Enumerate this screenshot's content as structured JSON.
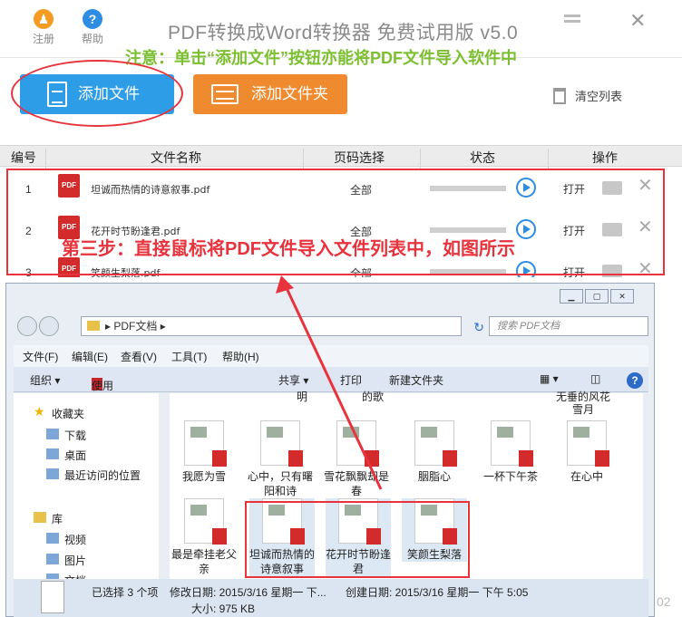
{
  "app": {
    "title": "PDF转换成Word转换器 免费试用版 v5.0",
    "notice": "注意：单击“添加文件”按钮亦能将PDF文件导入软件中",
    "register_label": "注册",
    "help_label": "帮助",
    "help_glyph": "?",
    "close_glyph": "✕"
  },
  "toolbar": {
    "add_file": "添加文件",
    "add_folder": "添加文件夹",
    "clear_list": "清空列表"
  },
  "table": {
    "headers": [
      "编号",
      "文件名称",
      "页码选择",
      "状态",
      "操作"
    ],
    "rows": [
      {
        "num": "1",
        "name": "坦诚而热情的诗意叙事.pdf",
        "pages": "全部",
        "open": "打开",
        "progress": 0,
        "pdf_tag": "PDF"
      },
      {
        "num": "2",
        "name": "花开时节盼逢君.pdf",
        "pages": "全部",
        "open": "打开",
        "progress": 0,
        "pdf_tag": "PDF"
      },
      {
        "num": "3",
        "name": "笑颜生梨落.pdf",
        "pages": "全部",
        "open": "打开",
        "progress": 0,
        "pdf_tag": "PDF"
      }
    ],
    "remove_glyph": "✕"
  },
  "annotation": {
    "step3": "第三步：直接鼠标将PDF文件导入文件列表中，如图所示"
  },
  "explorer": {
    "path": "PDF文档",
    "path_arrow": "▸",
    "search_placeholder": "搜索 PDF文档",
    "refresh_glyph": "↻",
    "menu": [
      "文件(F)",
      "编辑(E)",
      "查看(V)",
      "工具(T)",
      "帮助(H)"
    ],
    "commands": {
      "organize": "组织 ▾",
      "open_with": "使用 Adobe Reader XI 打开",
      "share": "共享 ▾",
      "print": "打印",
      "new_folder": "新建文件夹"
    },
    "sidebar": [
      {
        "label": "收藏夹"
      },
      {
        "label": "下载"
      },
      {
        "label": "桌面"
      },
      {
        "label": "最近访问的位置"
      },
      {
        "label": "库"
      },
      {
        "label": "视频"
      },
      {
        "label": "图片"
      },
      {
        "label": "文档"
      }
    ],
    "top_cut_labels": [
      "明",
      "的歌",
      "无垂的风花",
      "雪月"
    ],
    "files_row1": [
      "我愿为雪",
      "心中，只有曙阳和诗",
      "雪花飘飘却是春",
      "胭脂心",
      "一杯下午茶",
      "在心中"
    ],
    "files_row2": [
      "最是牵挂老父亲",
      "坦诚而热情的诗意叙事",
      "花开时节盼逢君",
      "笑颜生梨落"
    ],
    "status": {
      "selected": "已选择 3 个项",
      "modified": "修改日期: 2015/3/16 星期一 下...",
      "created": "创建日期: 2015/3/16 星期一 下午 5:05",
      "size": "大小: 975 KB"
    },
    "partial_right": "02"
  }
}
